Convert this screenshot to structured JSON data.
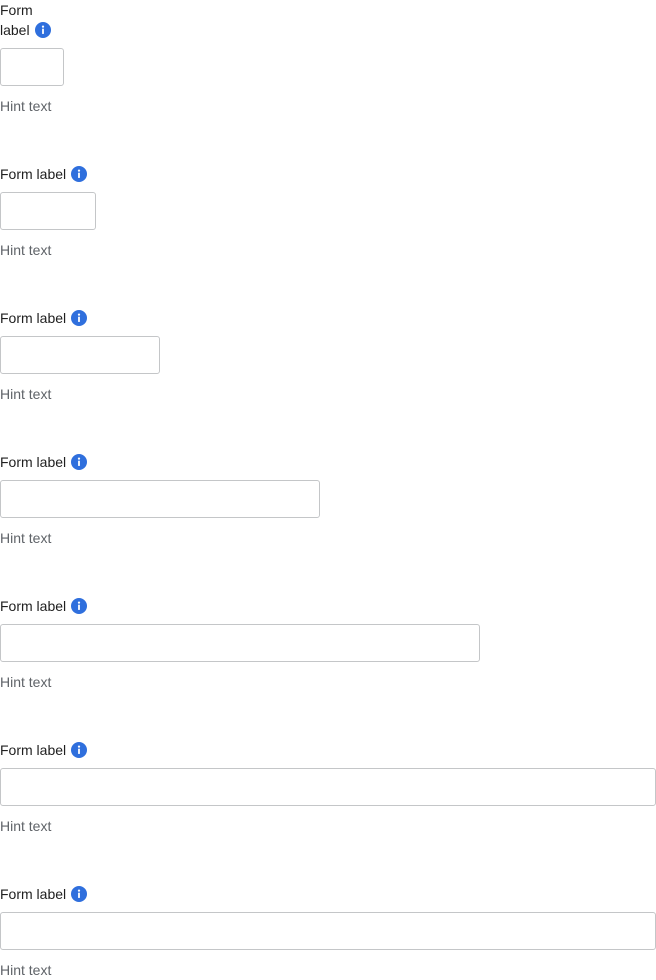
{
  "fields": [
    {
      "label_part1": "Form",
      "label_part2": "label",
      "info_icon": "info-icon",
      "hint": "Hint text",
      "value": "",
      "width_name": "xs"
    },
    {
      "label": "Form label",
      "info_icon": "info-icon",
      "hint": "Hint text",
      "value": "",
      "width_name": "s"
    },
    {
      "label": "Form label",
      "info_icon": "info-icon",
      "hint": "Hint text",
      "value": "",
      "width_name": "m"
    },
    {
      "label": "Form label",
      "info_icon": "info-icon",
      "hint": "Hint text",
      "value": "",
      "width_name": "l"
    },
    {
      "label": "Form label",
      "info_icon": "info-icon",
      "hint": "Hint text",
      "value": "",
      "width_name": "xl"
    },
    {
      "label": "Form label",
      "info_icon": "info-icon",
      "hint": "Hint text",
      "value": "",
      "width_name": "full"
    },
    {
      "label": "Form label",
      "info_icon": "info-icon",
      "hint": "Hint text",
      "value": "",
      "width_name": "full"
    }
  ],
  "colors": {
    "info_icon_bg": "#2f6fdd",
    "input_border": "#c4c6c8",
    "hint_text": "#5f6368",
    "label_text": "#1f1f1f"
  }
}
